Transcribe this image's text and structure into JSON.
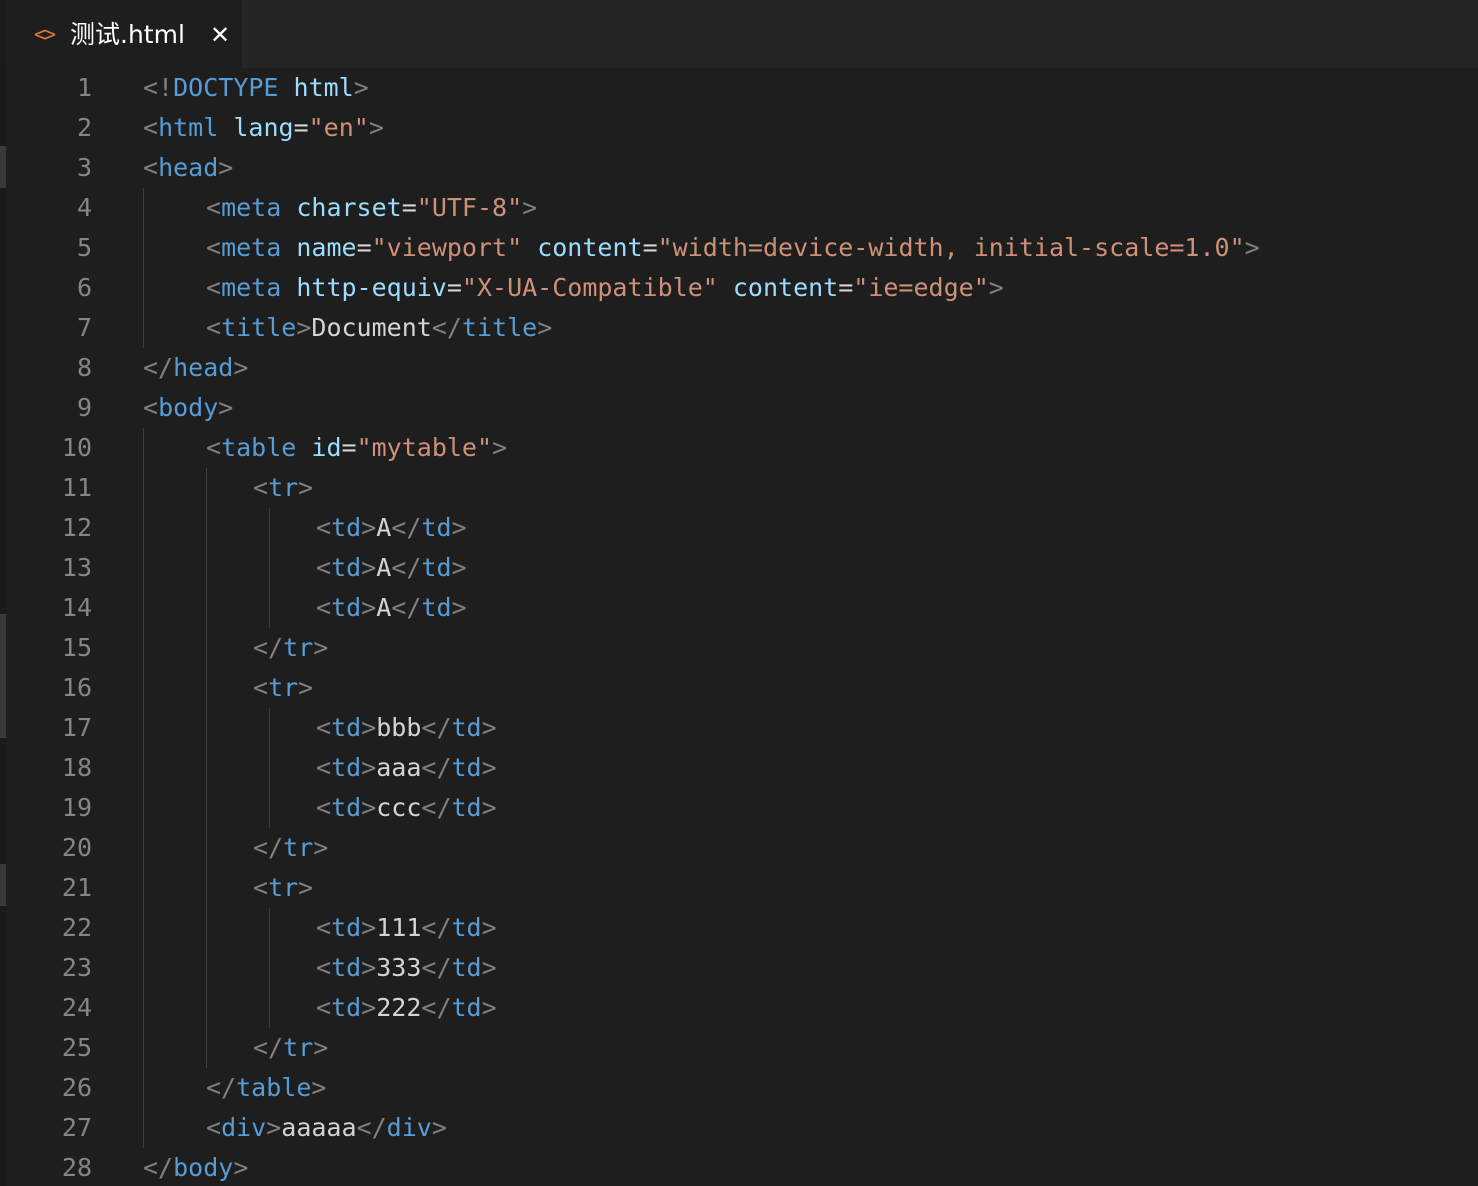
{
  "colors": {
    "background": "#1e1e1e",
    "tabbar_background": "#252526",
    "line_number": "#858585",
    "punctuation": "#808080",
    "tag": "#569cd6",
    "attribute": "#9cdcfe",
    "string": "#ce9178",
    "text": "#d4d4d4",
    "file_icon": "#e37933"
  },
  "tab": {
    "icon": "code-file-icon",
    "icon_glyph": "<>",
    "title": "测试.html",
    "close_glyph": "✕"
  },
  "editor": {
    "lines": [
      {
        "n": "1",
        "indent": 0,
        "tokens": [
          [
            "p",
            "<!"
          ],
          [
            "t",
            "DOCTYPE"
          ],
          [
            "x",
            " "
          ],
          [
            "a",
            "html"
          ],
          [
            "p",
            ">"
          ]
        ]
      },
      {
        "n": "2",
        "indent": 0,
        "tokens": [
          [
            "p",
            "<"
          ],
          [
            "t",
            "html"
          ],
          [
            "x",
            " "
          ],
          [
            "a",
            "lang"
          ],
          [
            "x",
            "="
          ],
          [
            "s",
            "\"en\""
          ],
          [
            "p",
            ">"
          ]
        ]
      },
      {
        "n": "3",
        "indent": 0,
        "tokens": [
          [
            "p",
            "<"
          ],
          [
            "t",
            "head"
          ],
          [
            "p",
            ">"
          ]
        ]
      },
      {
        "n": "4",
        "indent": 1,
        "tokens": [
          [
            "p",
            "<"
          ],
          [
            "t",
            "meta"
          ],
          [
            "x",
            " "
          ],
          [
            "a",
            "charset"
          ],
          [
            "x",
            "="
          ],
          [
            "s",
            "\"UTF-8\""
          ],
          [
            "p",
            ">"
          ]
        ]
      },
      {
        "n": "5",
        "indent": 1,
        "tokens": [
          [
            "p",
            "<"
          ],
          [
            "t",
            "meta"
          ],
          [
            "x",
            " "
          ],
          [
            "a",
            "name"
          ],
          [
            "x",
            "="
          ],
          [
            "s",
            "\"viewport\""
          ],
          [
            "x",
            " "
          ],
          [
            "a",
            "content"
          ],
          [
            "x",
            "="
          ],
          [
            "s",
            "\"width=device-width, initial-scale=1.0\""
          ],
          [
            "p",
            ">"
          ]
        ]
      },
      {
        "n": "6",
        "indent": 1,
        "tokens": [
          [
            "p",
            "<"
          ],
          [
            "t",
            "meta"
          ],
          [
            "x",
            " "
          ],
          [
            "a",
            "http-equiv"
          ],
          [
            "x",
            "="
          ],
          [
            "s",
            "\"X-UA-Compatible\""
          ],
          [
            "x",
            " "
          ],
          [
            "a",
            "content"
          ],
          [
            "x",
            "="
          ],
          [
            "s",
            "\"ie=edge\""
          ],
          [
            "p",
            ">"
          ]
        ]
      },
      {
        "n": "7",
        "indent": 1,
        "tokens": [
          [
            "p",
            "<"
          ],
          [
            "t",
            "title"
          ],
          [
            "p",
            ">"
          ],
          [
            "x",
            "Document"
          ],
          [
            "p",
            "</"
          ],
          [
            "t",
            "title"
          ],
          [
            "p",
            ">"
          ]
        ]
      },
      {
        "n": "8",
        "indent": 0,
        "tokens": [
          [
            "p",
            "</"
          ],
          [
            "t",
            "head"
          ],
          [
            "p",
            ">"
          ]
        ]
      },
      {
        "n": "9",
        "indent": 0,
        "tokens": [
          [
            "p",
            "<"
          ],
          [
            "t",
            "body"
          ],
          [
            "p",
            ">"
          ]
        ]
      },
      {
        "n": "10",
        "indent": 1,
        "tokens": [
          [
            "p",
            "<"
          ],
          [
            "t",
            "table"
          ],
          [
            "x",
            " "
          ],
          [
            "a",
            "id"
          ],
          [
            "x",
            "="
          ],
          [
            "s",
            "\"mytable\""
          ],
          [
            "p",
            ">"
          ]
        ]
      },
      {
        "n": "11",
        "indent": 2,
        "tokens": [
          [
            "p",
            "<"
          ],
          [
            "t",
            "tr"
          ],
          [
            "p",
            ">"
          ]
        ]
      },
      {
        "n": "12",
        "indent": 3,
        "tokens": [
          [
            "p",
            "<"
          ],
          [
            "t",
            "td"
          ],
          [
            "p",
            ">"
          ],
          [
            "x",
            "A"
          ],
          [
            "p",
            "</"
          ],
          [
            "t",
            "td"
          ],
          [
            "p",
            ">"
          ]
        ]
      },
      {
        "n": "13",
        "indent": 3,
        "tokens": [
          [
            "p",
            "<"
          ],
          [
            "t",
            "td"
          ],
          [
            "p",
            ">"
          ],
          [
            "x",
            "A"
          ],
          [
            "p",
            "</"
          ],
          [
            "t",
            "td"
          ],
          [
            "p",
            ">"
          ]
        ]
      },
      {
        "n": "14",
        "indent": 3,
        "tokens": [
          [
            "p",
            "<"
          ],
          [
            "t",
            "td"
          ],
          [
            "p",
            ">"
          ],
          [
            "x",
            "A"
          ],
          [
            "p",
            "</"
          ],
          [
            "t",
            "td"
          ],
          [
            "p",
            ">"
          ]
        ]
      },
      {
        "n": "15",
        "indent": 2,
        "tokens": [
          [
            "p",
            "</"
          ],
          [
            "t",
            "tr"
          ],
          [
            "p",
            ">"
          ]
        ]
      },
      {
        "n": "16",
        "indent": 2,
        "tokens": [
          [
            "p",
            "<"
          ],
          [
            "t",
            "tr"
          ],
          [
            "p",
            ">"
          ]
        ]
      },
      {
        "n": "17",
        "indent": 3,
        "tokens": [
          [
            "p",
            "<"
          ],
          [
            "t",
            "td"
          ],
          [
            "p",
            ">"
          ],
          [
            "x",
            "bbb"
          ],
          [
            "p",
            "</"
          ],
          [
            "t",
            "td"
          ],
          [
            "p",
            ">"
          ]
        ]
      },
      {
        "n": "18",
        "indent": 3,
        "tokens": [
          [
            "p",
            "<"
          ],
          [
            "t",
            "td"
          ],
          [
            "p",
            ">"
          ],
          [
            "x",
            "aaa"
          ],
          [
            "p",
            "</"
          ],
          [
            "t",
            "td"
          ],
          [
            "p",
            ">"
          ]
        ]
      },
      {
        "n": "19",
        "indent": 3,
        "tokens": [
          [
            "p",
            "<"
          ],
          [
            "t",
            "td"
          ],
          [
            "p",
            ">"
          ],
          [
            "x",
            "ccc"
          ],
          [
            "p",
            "</"
          ],
          [
            "t",
            "td"
          ],
          [
            "p",
            ">"
          ]
        ]
      },
      {
        "n": "20",
        "indent": 2,
        "tokens": [
          [
            "p",
            "</"
          ],
          [
            "t",
            "tr"
          ],
          [
            "p",
            ">"
          ]
        ]
      },
      {
        "n": "21",
        "indent": 2,
        "tokens": [
          [
            "p",
            "<"
          ],
          [
            "t",
            "tr"
          ],
          [
            "p",
            ">"
          ]
        ]
      },
      {
        "n": "22",
        "indent": 3,
        "tokens": [
          [
            "p",
            "<"
          ],
          [
            "t",
            "td"
          ],
          [
            "p",
            ">"
          ],
          [
            "x",
            "111"
          ],
          [
            "p",
            "</"
          ],
          [
            "t",
            "td"
          ],
          [
            "p",
            ">"
          ]
        ]
      },
      {
        "n": "23",
        "indent": 3,
        "tokens": [
          [
            "p",
            "<"
          ],
          [
            "t",
            "td"
          ],
          [
            "p",
            ">"
          ],
          [
            "x",
            "333"
          ],
          [
            "p",
            "</"
          ],
          [
            "t",
            "td"
          ],
          [
            "p",
            ">"
          ]
        ]
      },
      {
        "n": "24",
        "indent": 3,
        "tokens": [
          [
            "p",
            "<"
          ],
          [
            "t",
            "td"
          ],
          [
            "p",
            ">"
          ],
          [
            "x",
            "222"
          ],
          [
            "p",
            "</"
          ],
          [
            "t",
            "td"
          ],
          [
            "p",
            ">"
          ]
        ]
      },
      {
        "n": "25",
        "indent": 2,
        "tokens": [
          [
            "p",
            "</"
          ],
          [
            "t",
            "tr"
          ],
          [
            "p",
            ">"
          ]
        ]
      },
      {
        "n": "26",
        "indent": 1,
        "tokens": [
          [
            "p",
            "</"
          ],
          [
            "t",
            "table"
          ],
          [
            "p",
            ">"
          ]
        ]
      },
      {
        "n": "27",
        "indent": 1,
        "tokens": [
          [
            "p",
            "<"
          ],
          [
            "t",
            "div"
          ],
          [
            "p",
            ">"
          ],
          [
            "x",
            "aaaaa"
          ],
          [
            "p",
            "</"
          ],
          [
            "t",
            "div"
          ],
          [
            "p",
            ">"
          ]
        ]
      },
      {
        "n": "28",
        "indent": 0,
        "tokens": [
          [
            "p",
            "</"
          ],
          [
            "t",
            "body"
          ],
          [
            "p",
            ">"
          ]
        ]
      }
    ]
  }
}
